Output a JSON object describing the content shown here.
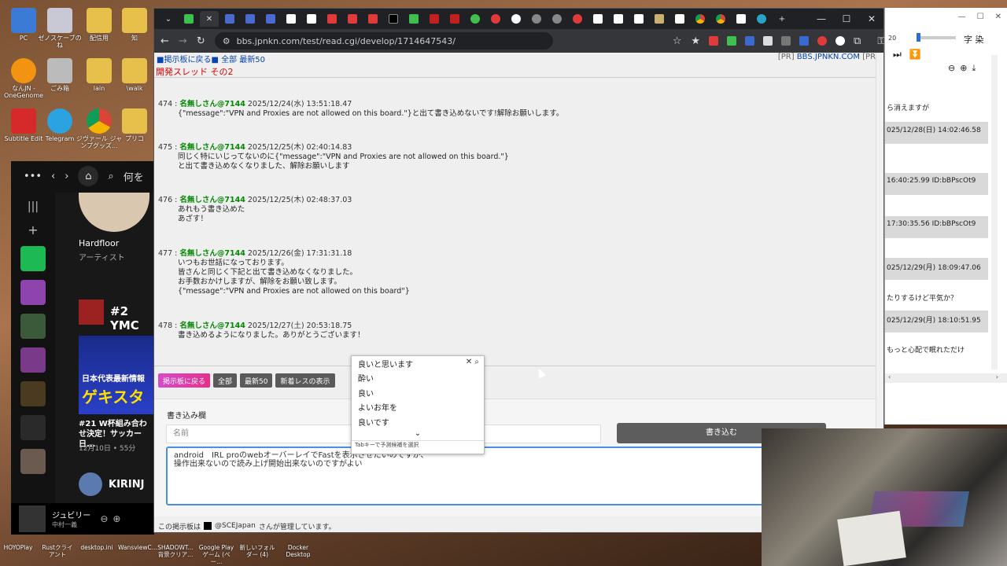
{
  "desktop": {
    "icons": [
      {
        "label": "PC",
        "color": "#3b7bd6"
      },
      {
        "label": "ゼノスケーブのね",
        "color": "#c9c9d6"
      },
      {
        "label": "配信用",
        "color": "#e6c04a"
      },
      {
        "label": "知",
        "color": "#e6c04a"
      },
      {
        "label": "なんJN - OneGenome",
        "color": "#f29411"
      },
      {
        "label": "ごみ箱",
        "color": "#bbbbbb"
      },
      {
        "label": "lain",
        "color": "#e6c04a"
      },
      {
        "label": "\\walk",
        "color": "#e6c04a"
      },
      {
        "label": "Subtitle Edit",
        "color": "#d62a2a"
      },
      {
        "label": "Telegram",
        "color": "#2aa3e0"
      },
      {
        "label": "ジヴァール ジャンプグッズ...",
        "color": "#e8e8e8"
      },
      {
        "label": "プリコ",
        "color": "#e6c04a"
      }
    ],
    "taskbar_labels": [
      "HOYOPlay",
      "Rustクライアント",
      "desktop.ini",
      "WansviewC...",
      "SHADOWT... 背景クリア...",
      "Google Play ゲーム (ベー...",
      "新しいフォルダー (4)",
      "Docker Desktop"
    ]
  },
  "spotify": {
    "search_placeholder": "何を",
    "artist_name": "Hardfloor",
    "artist_type": "アーティスト",
    "item_2ymc": "#2 YMC",
    "banner_text": "日本代表最新情報",
    "banner_logo": "ゲキスタ",
    "episode_title": "#21 W杯組み合わせ決定！サッカー日...",
    "episode_meta": "12月10日 • 55分",
    "kirin": "KIRINJ",
    "now_title": "ジュビリー",
    "now_artist": "中村一義"
  },
  "browser": {
    "url": "bbs.jpnkn.com/test/read.cgi/develop/1714647543/",
    "topnav_left": "■掲示板に戻る■ 全部 最新50",
    "topnav_pr": "[PR]",
    "topnav_site": "BBS.JPNKN.COM",
    "topnav_pr2": "[PR]",
    "thread_title": "開発スレッド その2",
    "posts": [
      {
        "num": "474",
        "name": "名無しさん@7144",
        "date": "2025/12/24(水) 13:51:18.47",
        "lines": [
          "{\"message\":\"VPN and Proxies are not allowed on this board.\"}と出て書き込めないです!解除お願いします。"
        ]
      },
      {
        "num": "475",
        "name": "名無しさん@7144",
        "date": "2025/12/25(木) 02:40:14.83",
        "lines": [
          "同じく特にいじってないのに{\"message\":\"VPN and Proxies are not allowed on this board.\"}",
          "と出て書き込めなくなりました、解除お願いします"
        ]
      },
      {
        "num": "476",
        "name": "名無しさん@7144",
        "date": "2025/12/25(木) 02:48:37.03",
        "lines": [
          "あれもう書き込めた",
          "あざす！"
        ]
      },
      {
        "num": "477",
        "name": "名無しさん@7144",
        "date": "2025/12/26(金) 17:31:31.18",
        "lines": [
          "いつもお世話になっております。",
          "皆さんと同じく下記と出て書き込めなくなりました。",
          "お手数おかけしますが、解除をお願い致します。",
          "{\"message\":\"VPN and Proxies are not allowed on this board\"}"
        ]
      },
      {
        "num": "478",
        "name": "名無しさん@7144",
        "date": "2025/12/27(土) 20:53:18.75",
        "lines": [
          "書き込めるようになりました。ありがとうございます！"
        ]
      }
    ],
    "buttons": [
      "掲示板に戻る",
      "全部",
      "最新50",
      "新着レスの表示"
    ],
    "form_label": "書き込み欄",
    "name_placeholder": "名前",
    "submit_label": "書き込む",
    "textarea_value": "android　IRL proのwebオーバーレイでFastを表示させたいのですが、\n操作出来ないので読み上げ開始出来ないのですがよい",
    "footer_prefix": "この掲示板は",
    "footer_handle": "@SCEJapan",
    "footer_suffix": "さんが管理しています。"
  },
  "ime": {
    "candidates": [
      "良いと思います",
      "酔い",
      "良い",
      "よいお年を",
      "良いです"
    ],
    "hint": "Tabキーで予測候補を選択"
  },
  "rightwin": {
    "zoom_value": "20",
    "char_label": "字 染",
    "rows": [
      "ら消えますが",
      "025/12/28(日) 14:02:46.58",
      "16:40:25.99 ID:bBPscOt9",
      "17:30:35.56 ID:bBPscOt9",
      "025/12/29(月) 18:09:47.06",
      "たりするけど平気か？",
      "025/12/29(月) 18:10:51.95",
      "もっと心配で眠れただけ"
    ]
  }
}
